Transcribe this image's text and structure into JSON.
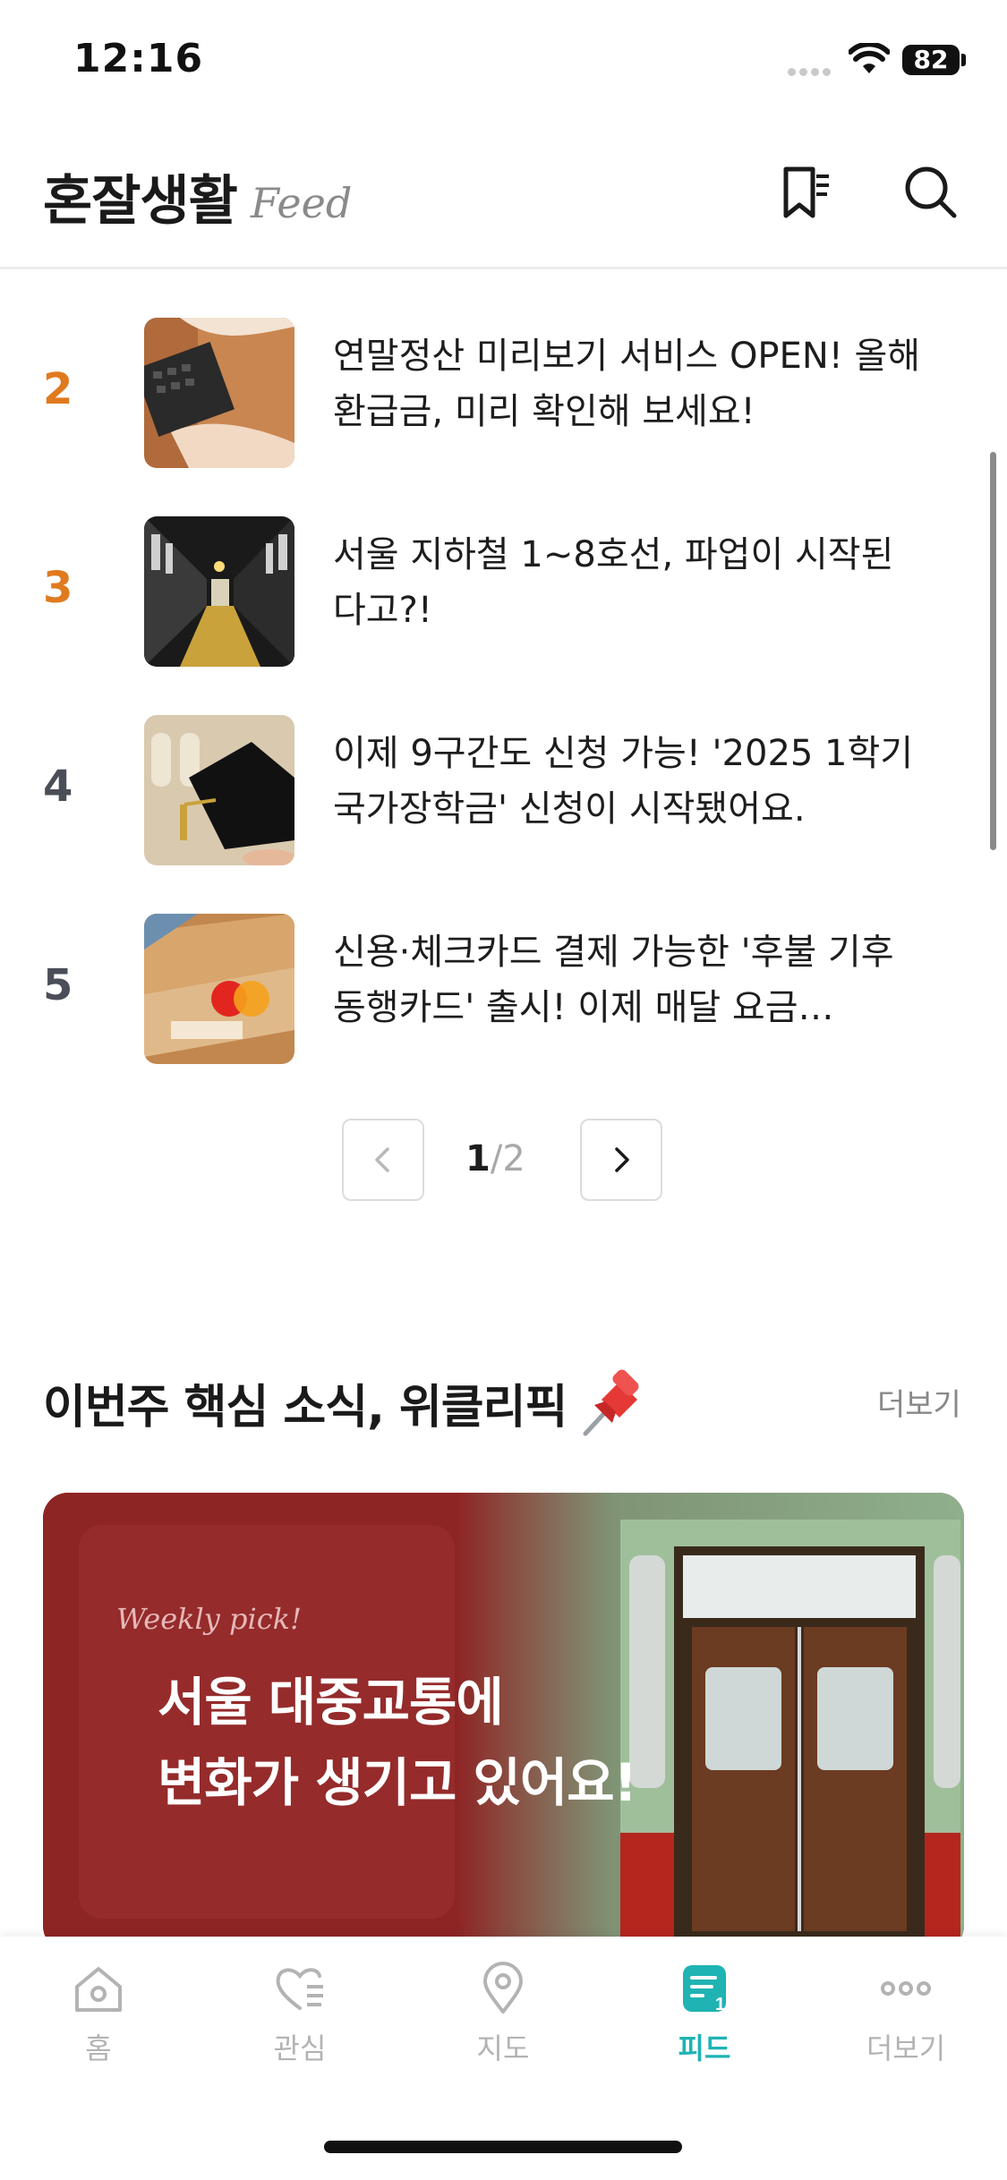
{
  "status": {
    "time": "12:16",
    "battery": "82"
  },
  "header": {
    "title": "혼잘생활",
    "subtitle": "Feed",
    "icons": [
      "bookmark-list-icon",
      "search-icon"
    ]
  },
  "list": [
    {
      "rank": "2",
      "title": "연말정산 미리보기 서비스 OPEN! 올해 환급금, 미리 확인해 보세요!",
      "rank_color": "#e07a1f"
    },
    {
      "rank": "3",
      "title": "서울 지하철 1~8호선, 파업이 시작된다고?!",
      "rank_color": "#e07a1f"
    },
    {
      "rank": "4",
      "title": "이제 9구간도 신청 가능! '2025 1학기 국가장학금' 신청이 시작됐어요.",
      "rank_color": "#4a4f57"
    },
    {
      "rank": "5",
      "title": "신용·체크카드 결제 가능한 '후불 기후동행카드' 출시! 이제 매달 요금…",
      "rank_color": "#4a4f57"
    }
  ],
  "pagination": {
    "current": "1",
    "separator": "/",
    "total": "2"
  },
  "section": {
    "title": "이번주 핵심 소식, 위클리픽",
    "more": "더보기"
  },
  "banner": {
    "kicker": "Weekly pick!",
    "line1": "서울 대중교통에",
    "line2": "변화가 생기고 있어요!"
  },
  "tabs": [
    {
      "label": "홈",
      "icon": "home-icon"
    },
    {
      "label": "관심",
      "icon": "heart-list-icon"
    },
    {
      "label": "지도",
      "icon": "map-pin-icon"
    },
    {
      "label": "피드",
      "icon": "feed-icon",
      "active": true
    },
    {
      "label": "더보기",
      "icon": "more-dots-icon"
    }
  ],
  "colors": {
    "accent": "#1fb3b3",
    "rank_top": "#e07a1f",
    "banner": "#8e2525"
  }
}
